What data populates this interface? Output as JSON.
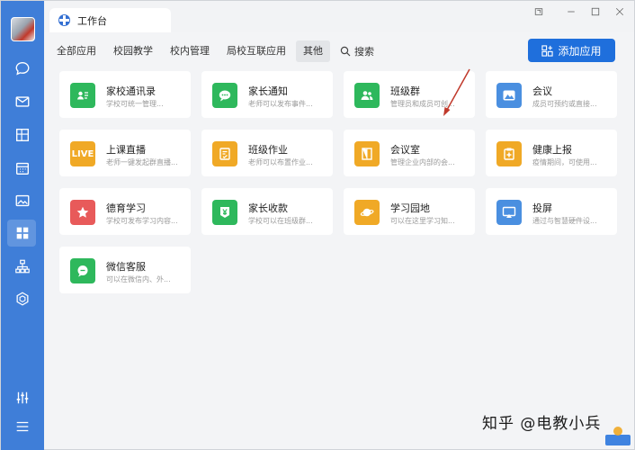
{
  "window": {
    "tab_title": "工作台",
    "controls": [
      "pin-icon",
      "minimize-icon",
      "maximize-icon",
      "close-icon"
    ]
  },
  "sidebar": {
    "items": [
      {
        "icon": "chat-icon"
      },
      {
        "icon": "mail-icon"
      },
      {
        "icon": "document-icon"
      },
      {
        "icon": "calendar-icon"
      },
      {
        "icon": "image-icon"
      },
      {
        "icon": "grid-icon",
        "active": true
      },
      {
        "icon": "org-chart-icon"
      },
      {
        "icon": "cube-icon"
      }
    ],
    "bottom": [
      {
        "icon": "sliders-icon"
      },
      {
        "icon": "menu-icon"
      }
    ]
  },
  "nav": {
    "tabs": [
      "全部应用",
      "校园教学",
      "校内管理",
      "局校互联应用",
      "其他"
    ],
    "active_tab": "其他",
    "search_label": "搜索"
  },
  "add_button": {
    "label": "添加应用"
  },
  "apps": [
    {
      "title": "家校通讯录",
      "desc": "学校可统一管理...",
      "color": "#2eb85c",
      "icon": "contact-card-icon"
    },
    {
      "title": "家长通知",
      "desc": "老师可以发布事件...",
      "color": "#2eb85c",
      "icon": "chat-bubble-icon"
    },
    {
      "title": "班级群",
      "desc": "管理员和成员可创...",
      "color": "#2eb85c",
      "icon": "people-icon"
    },
    {
      "title": "会议",
      "desc": "成员可预约或直接...",
      "color": "#4a8fe0",
      "icon": "mountain-icon"
    },
    {
      "title": "上课直播",
      "desc": "老师一键发起群直播...",
      "color": "#f0a926",
      "icon": "live-badge-icon",
      "icon_text": "LIVE"
    },
    {
      "title": "班级作业",
      "desc": "老师可以布置作业...",
      "color": "#f0a926",
      "icon": "homework-icon"
    },
    {
      "title": "会议室",
      "desc": "管理企业内部的会...",
      "color": "#f0a926",
      "icon": "door-icon"
    },
    {
      "title": "健康上报",
      "desc": "疫情期间，可使用...",
      "color": "#f0a926",
      "icon": "health-clipboard-icon"
    },
    {
      "title": "德育学习",
      "desc": "学校可发布学习内容...",
      "color": "#e85a5a",
      "icon": "star-icon"
    },
    {
      "title": "家长收款",
      "desc": "学校可以在班级群...",
      "color": "#2eb85c",
      "icon": "yuan-icon"
    },
    {
      "title": "学习园地",
      "desc": "可以在这里学习知...",
      "color": "#f0a926",
      "icon": "planet-icon"
    },
    {
      "title": "投屏",
      "desc": "通过与智慧硬件设...",
      "color": "#4a8fe0",
      "icon": "cast-screen-icon"
    },
    {
      "title": "微信客服",
      "desc": "可以在微信内、外...",
      "color": "#2eb85c",
      "icon": "wechat-service-icon"
    }
  ],
  "watermark": {
    "text": "知乎 @电教小兵"
  }
}
